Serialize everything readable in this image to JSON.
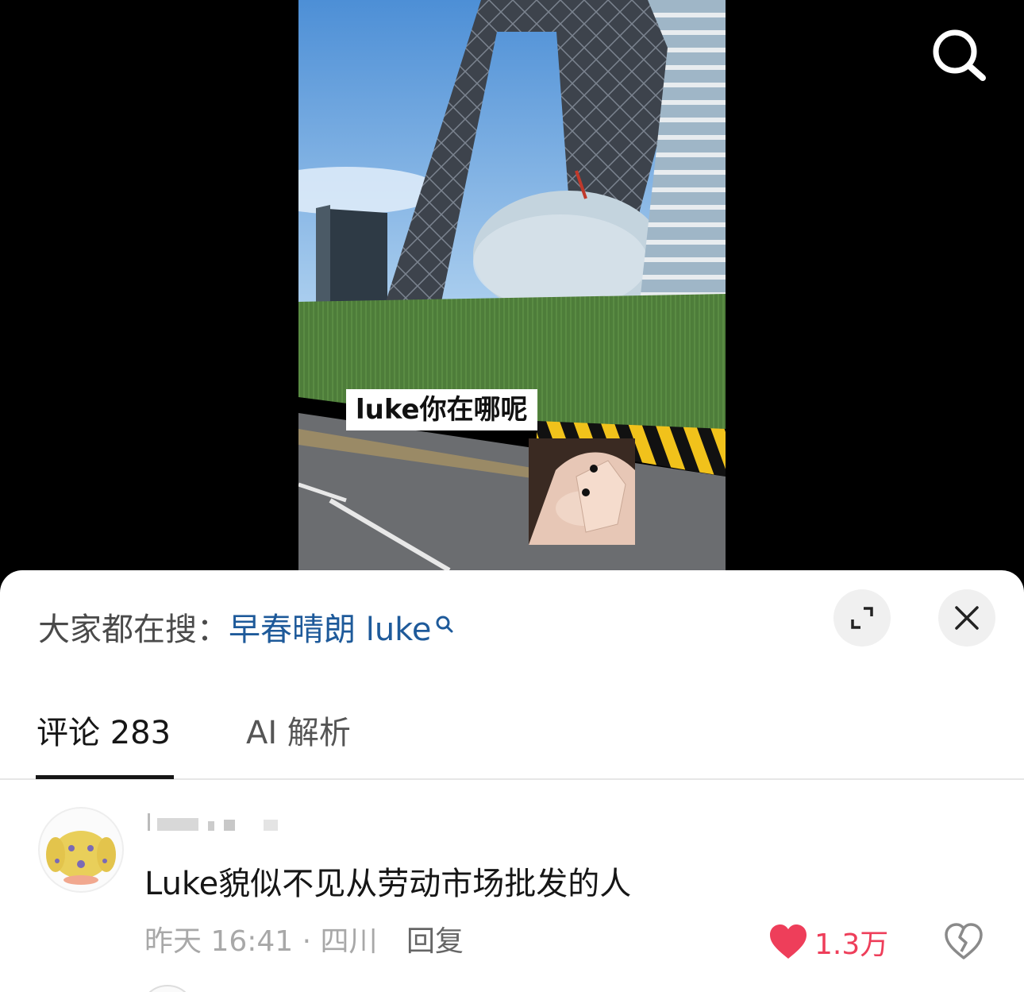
{
  "video": {
    "caption": "luke你在哪呢"
  },
  "hot_search": {
    "prefix": "大家都在搜：",
    "term": "早春晴朗 luke"
  },
  "tabs": [
    {
      "label": "评论 283"
    },
    {
      "label": "AI 解析"
    }
  ],
  "comment": {
    "text": "Luke貌似不见从劳动市场批发的人",
    "meta": "昨天 16:41 · 四川",
    "reply_label": "回复",
    "like_count": "1.3万"
  },
  "icons": {
    "search": "search-icon",
    "expand": "expand-icon",
    "close": "close-icon",
    "like": "heart-icon",
    "dislike": "broken-heart-icon"
  },
  "colors": {
    "accent_link": "#1e5a9a",
    "like_red": "#ee3e5a"
  }
}
